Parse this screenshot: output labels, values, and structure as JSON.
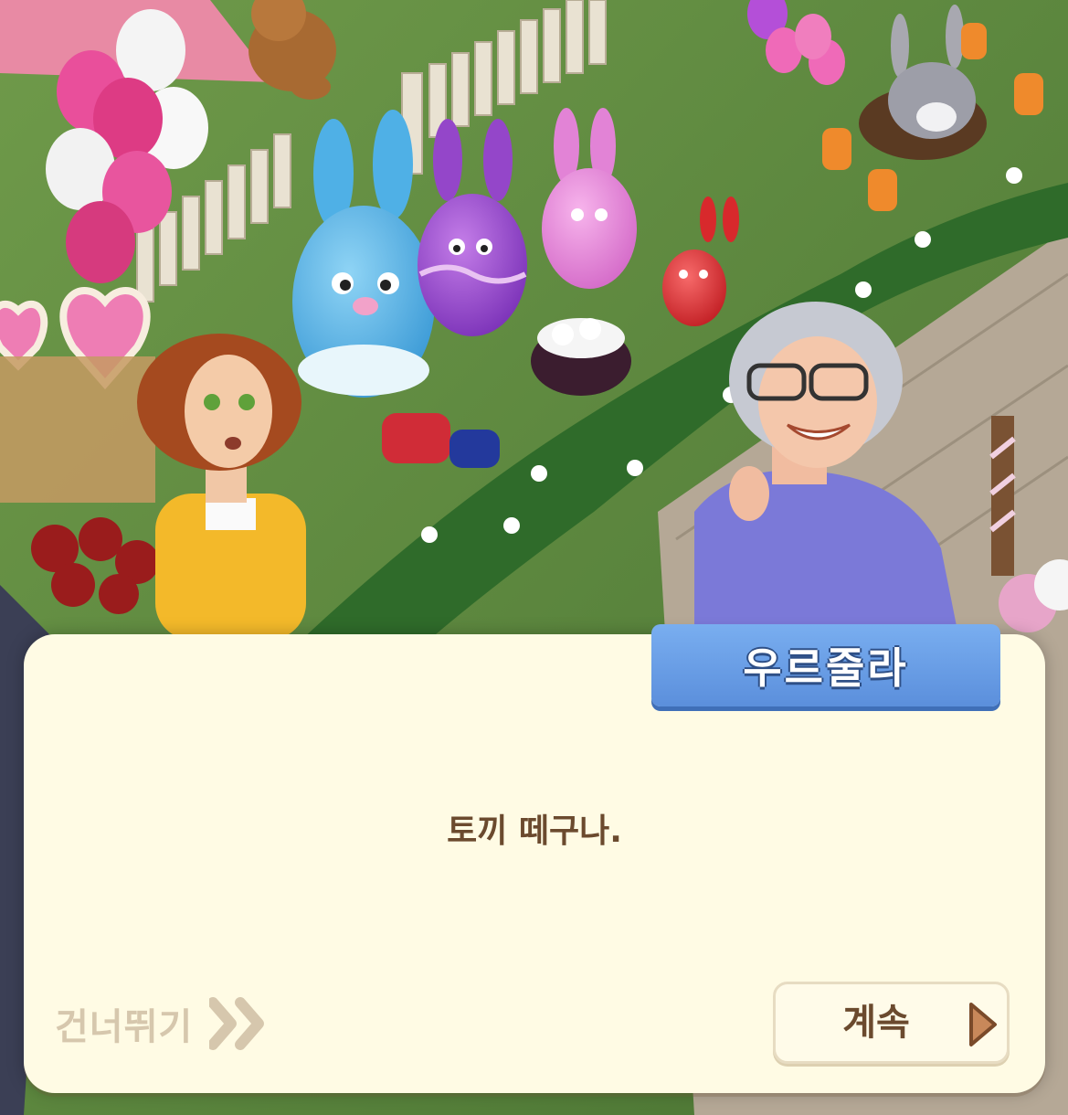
{
  "dialog": {
    "speaker": "우르줄라",
    "text": "토끼 떼구나."
  },
  "controls": {
    "skip_label": "건너뛰기",
    "continue_label": "계속"
  },
  "colors": {
    "dialog_bg": "#fffbe4",
    "name_tag": "#5b8fdc",
    "text": "#6b4a2e",
    "skip_text": "#d6c7ad",
    "arrow": "#c8885a"
  },
  "icons": {
    "skip": "double-chevron-right-icon",
    "continue": "play-triangle-icon"
  }
}
